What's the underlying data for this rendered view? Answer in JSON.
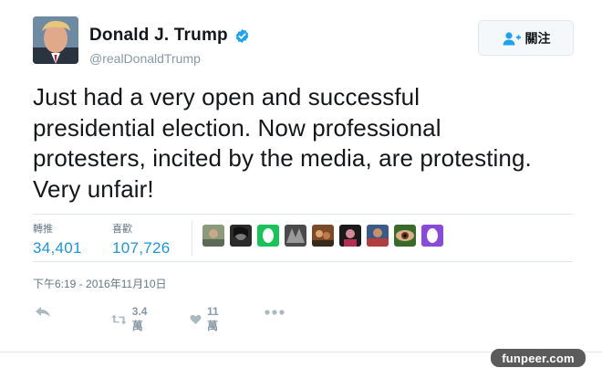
{
  "author": {
    "display_name": "Donald J. Trump",
    "handle": "@realDonaldTrump",
    "verified": true
  },
  "follow_button": {
    "label": "關注",
    "icon": "add-user-icon"
  },
  "tweet": {
    "lines": [
      "Just had a very open and successful",
      "presidential election. Now professional",
      "protesters, incited by the media, are protesting.",
      "Very unfair!"
    ]
  },
  "stats": {
    "retweets": {
      "label": "轉推",
      "value": "34,401"
    },
    "likes": {
      "label": "喜歡",
      "value": "107,726"
    }
  },
  "likers_count_shown": 9,
  "timestamp": "下午6:19 - 2016年11月10日",
  "actions": {
    "reply": {
      "icon": "reply-icon"
    },
    "retweet": {
      "icon": "retweet-icon",
      "count": "3.4萬"
    },
    "like": {
      "icon": "heart-icon",
      "count": "11萬"
    },
    "more": {
      "icon": "more-icon"
    }
  },
  "watermark": "funpeer.com",
  "colors": {
    "link_blue": "#1b95e0",
    "verified_blue": "#1da1f2",
    "muted_gray": "#8899a6",
    "text_dark": "#14171a"
  }
}
